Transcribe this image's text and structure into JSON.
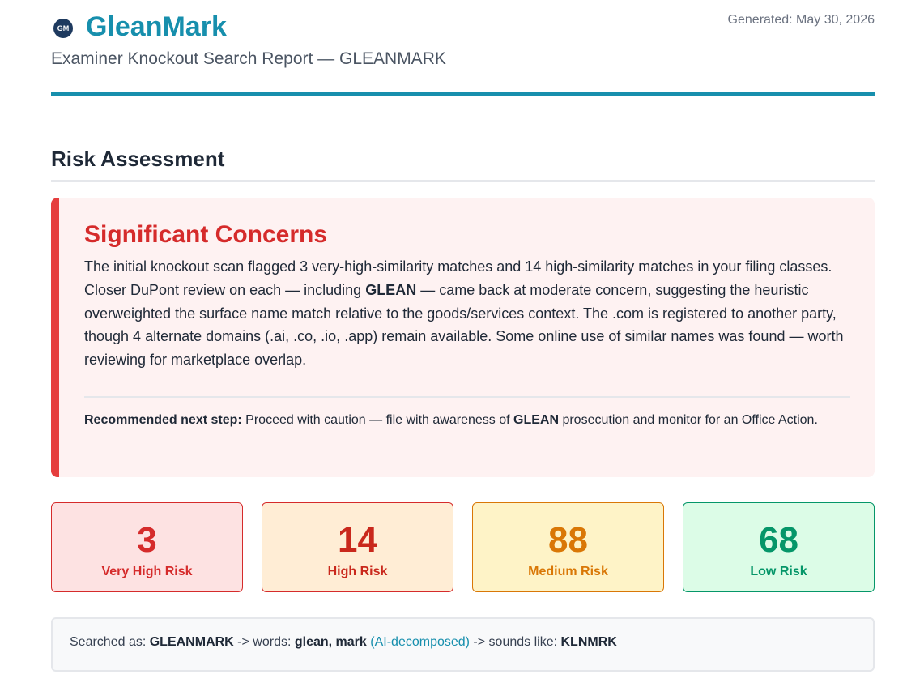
{
  "header": {
    "logo_text": "GM",
    "brand": "GleanMark",
    "subtitle": "Examiner Knockout Search Report — GLEANMARK",
    "generated": "Generated: May 30, 2026"
  },
  "section": {
    "title": "Risk Assessment"
  },
  "concern": {
    "title": "Significant Concerns",
    "body_before": "The initial knockout scan flagged 3 very-high-similarity matches and 14 high-similarity matches in your filing classes. Closer DuPont review on each — including ",
    "body_mark": "GLEAN",
    "body_after": " — came back at moderate concern, suggesting the heuristic overweighted the surface name match relative to the goods/services context. The .com is registered to another party, though 4 alternate domains (.ai, .co, .io, .app) remain available. Some online use of similar names was found — worth reviewing for marketplace overlap.",
    "next_step_label": "Recommended next step:",
    "next_step_before": " Proceed with caution — file with awareness of ",
    "next_step_mark": "GLEAN",
    "next_step_after": " prosecution and monitor for an Office Action."
  },
  "stats": [
    {
      "value": "3",
      "label": "Very High Risk",
      "color": "#d52b2b"
    },
    {
      "value": "14",
      "label": "High Risk",
      "color": "#c9281c"
    },
    {
      "value": "88",
      "label": "Medium Risk",
      "color": "#d97706"
    },
    {
      "value": "68",
      "label": "Low Risk",
      "color": "#059669"
    }
  ],
  "search": {
    "prefix": "Searched as: ",
    "term": "GLEANMARK",
    "words_prefix": " -> words: ",
    "words": "glean, mark",
    "ai_tag": "(AI-decomposed)",
    "sounds_prefix": " -> sounds like: ",
    "phonetic": "KLNMRK"
  },
  "colors": {
    "accent": "#178fad",
    "danger": "#e53e3e"
  }
}
